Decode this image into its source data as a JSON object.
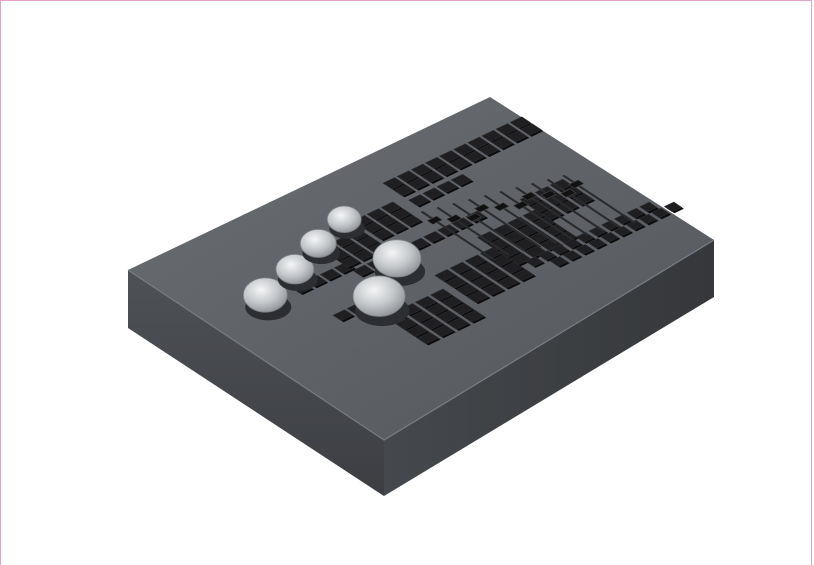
{
  "image": {
    "subject": "lighting-control-console",
    "background_color": "#ffffff",
    "frame_color": "#e5a3c6",
    "body_color": "#5b5e63",
    "key_color": "#1c1c1e",
    "knob_color": "#c9ccce"
  }
}
